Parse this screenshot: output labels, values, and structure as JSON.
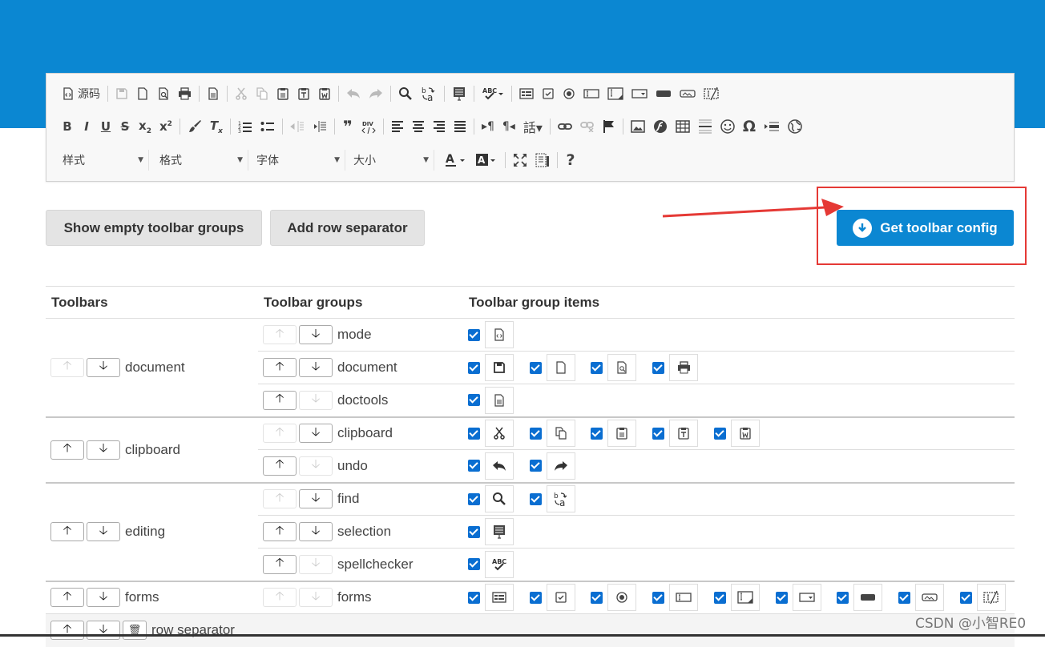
{
  "editor": {
    "source_label": "源码",
    "combos": [
      {
        "label": "样式"
      },
      {
        "label": "格式"
      },
      {
        "label": "字体"
      },
      {
        "label": "大小"
      }
    ],
    "row1_icons": [
      "source-icon",
      "save-icon",
      "new-page-icon",
      "preview-icon",
      "print-icon",
      "templates-icon",
      "cut-icon",
      "copy-icon",
      "paste-icon",
      "paste-text-icon",
      "paste-word-icon",
      "undo-icon",
      "redo-icon",
      "find-icon",
      "replace-icon",
      "select-all-icon",
      "spellcheck-icon",
      "form-icon",
      "checkbox-icon",
      "radio-icon",
      "textfield-icon",
      "textarea-icon",
      "select-icon",
      "button-icon",
      "image-button-icon",
      "hidden-field-icon"
    ],
    "help_label": "?"
  },
  "buttons": {
    "show_empty": "Show empty toolbar groups",
    "add_row_sep": "Add row separator",
    "get_config": "Get toolbar config"
  },
  "table": {
    "headers": [
      "Toolbars",
      "Toolbar groups",
      "Toolbar group items"
    ],
    "rows": [
      {
        "toolbar": "document",
        "groups": [
          "mode",
          "document",
          "doctools"
        ]
      },
      {
        "toolbar": "clipboard",
        "groups": [
          "clipboard",
          "undo"
        ]
      },
      {
        "toolbar": "editing",
        "groups": [
          "find",
          "selection",
          "spellchecker"
        ]
      },
      {
        "toolbar": "forms",
        "groups": [
          "forms"
        ]
      },
      {
        "toolbar": "row separator",
        "groups": []
      }
    ]
  },
  "watermark": "CSDN @小智RE0",
  "colors": {
    "header_blue": "#0b87d2",
    "checkbox_blue": "#0a6ed1",
    "annotation_red": "#e53935"
  }
}
